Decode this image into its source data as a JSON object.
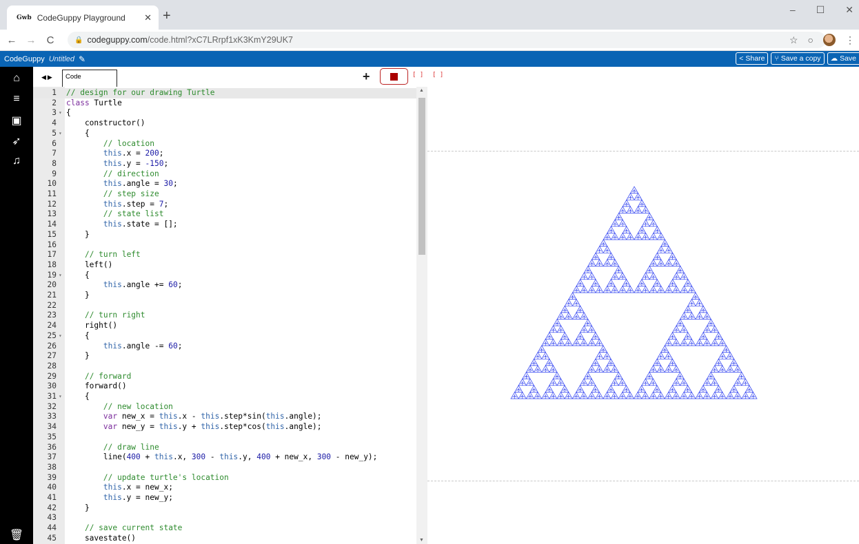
{
  "browser": {
    "tab_title": "CodeGuppy Playground",
    "tab_favicon": "Gwb",
    "url_host": "codeguppy.com",
    "url_path": "/code.html?xC7LRrpf1xK3KmY29UK7"
  },
  "app": {
    "brand": "CodeGuppy",
    "title": "Untitled",
    "buttons": {
      "share": "Share",
      "save_copy": "Save a copy",
      "save": "Save"
    }
  },
  "editor": {
    "tab_label": "Code",
    "lines": [
      {
        "n": "1",
        "t": "// design for our drawing Turtle"
      },
      {
        "n": "2",
        "t": "class Turtle"
      },
      {
        "n": "3",
        "t": "{",
        "f": true
      },
      {
        "n": "4",
        "t": "    constructor()"
      },
      {
        "n": "5",
        "t": "    {",
        "f": true
      },
      {
        "n": "6",
        "t": "        // location"
      },
      {
        "n": "7",
        "t": "        this.x = 200;"
      },
      {
        "n": "8",
        "t": "        this.y = -150;"
      },
      {
        "n": "9",
        "t": "        // direction"
      },
      {
        "n": "10",
        "t": "        this.angle = 30;"
      },
      {
        "n": "11",
        "t": "        // step size"
      },
      {
        "n": "12",
        "t": "        this.step = 7;"
      },
      {
        "n": "13",
        "t": "        // state list"
      },
      {
        "n": "14",
        "t": "        this.state = [];"
      },
      {
        "n": "15",
        "t": "    }"
      },
      {
        "n": "16",
        "t": ""
      },
      {
        "n": "17",
        "t": "    // turn left"
      },
      {
        "n": "18",
        "t": "    left()"
      },
      {
        "n": "19",
        "t": "    {",
        "f": true
      },
      {
        "n": "20",
        "t": "        this.angle += 60;"
      },
      {
        "n": "21",
        "t": "    }"
      },
      {
        "n": "22",
        "t": ""
      },
      {
        "n": "23",
        "t": "    // turn right"
      },
      {
        "n": "24",
        "t": "    right()"
      },
      {
        "n": "25",
        "t": "    {",
        "f": true
      },
      {
        "n": "26",
        "t": "        this.angle -= 60;"
      },
      {
        "n": "27",
        "t": "    }"
      },
      {
        "n": "28",
        "t": ""
      },
      {
        "n": "29",
        "t": "    // forward"
      },
      {
        "n": "30",
        "t": "    forward()"
      },
      {
        "n": "31",
        "t": "    {",
        "f": true
      },
      {
        "n": "32",
        "t": "        // new location"
      },
      {
        "n": "33",
        "t": "        var new_x = this.x - this.step*sin(this.angle);"
      },
      {
        "n": "34",
        "t": "        var new_y = this.y + this.step*cos(this.angle);"
      },
      {
        "n": "35",
        "t": ""
      },
      {
        "n": "36",
        "t": "        // draw line"
      },
      {
        "n": "37",
        "t": "        line(400 + this.x, 300 - this.y, 400 + new_x, 300 - new_y);"
      },
      {
        "n": "38",
        "t": ""
      },
      {
        "n": "39",
        "t": "        // update turtle's location"
      },
      {
        "n": "40",
        "t": "        this.x = new_x;"
      },
      {
        "n": "41",
        "t": "        this.y = new_y;"
      },
      {
        "n": "42",
        "t": "    }"
      },
      {
        "n": "43",
        "t": ""
      },
      {
        "n": "44",
        "t": "    // save current state"
      },
      {
        "n": "45",
        "t": "    savestate()"
      }
    ]
  },
  "colors": {
    "app_bar": "#0a64b4",
    "sidebar": "#000000",
    "fractal": "#2a3cf0",
    "stop": "#aa0000"
  },
  "sidebar_icons": [
    "home-icon",
    "menu-icon",
    "image-icon",
    "rocket-icon",
    "music-icon",
    "trash-icon"
  ]
}
